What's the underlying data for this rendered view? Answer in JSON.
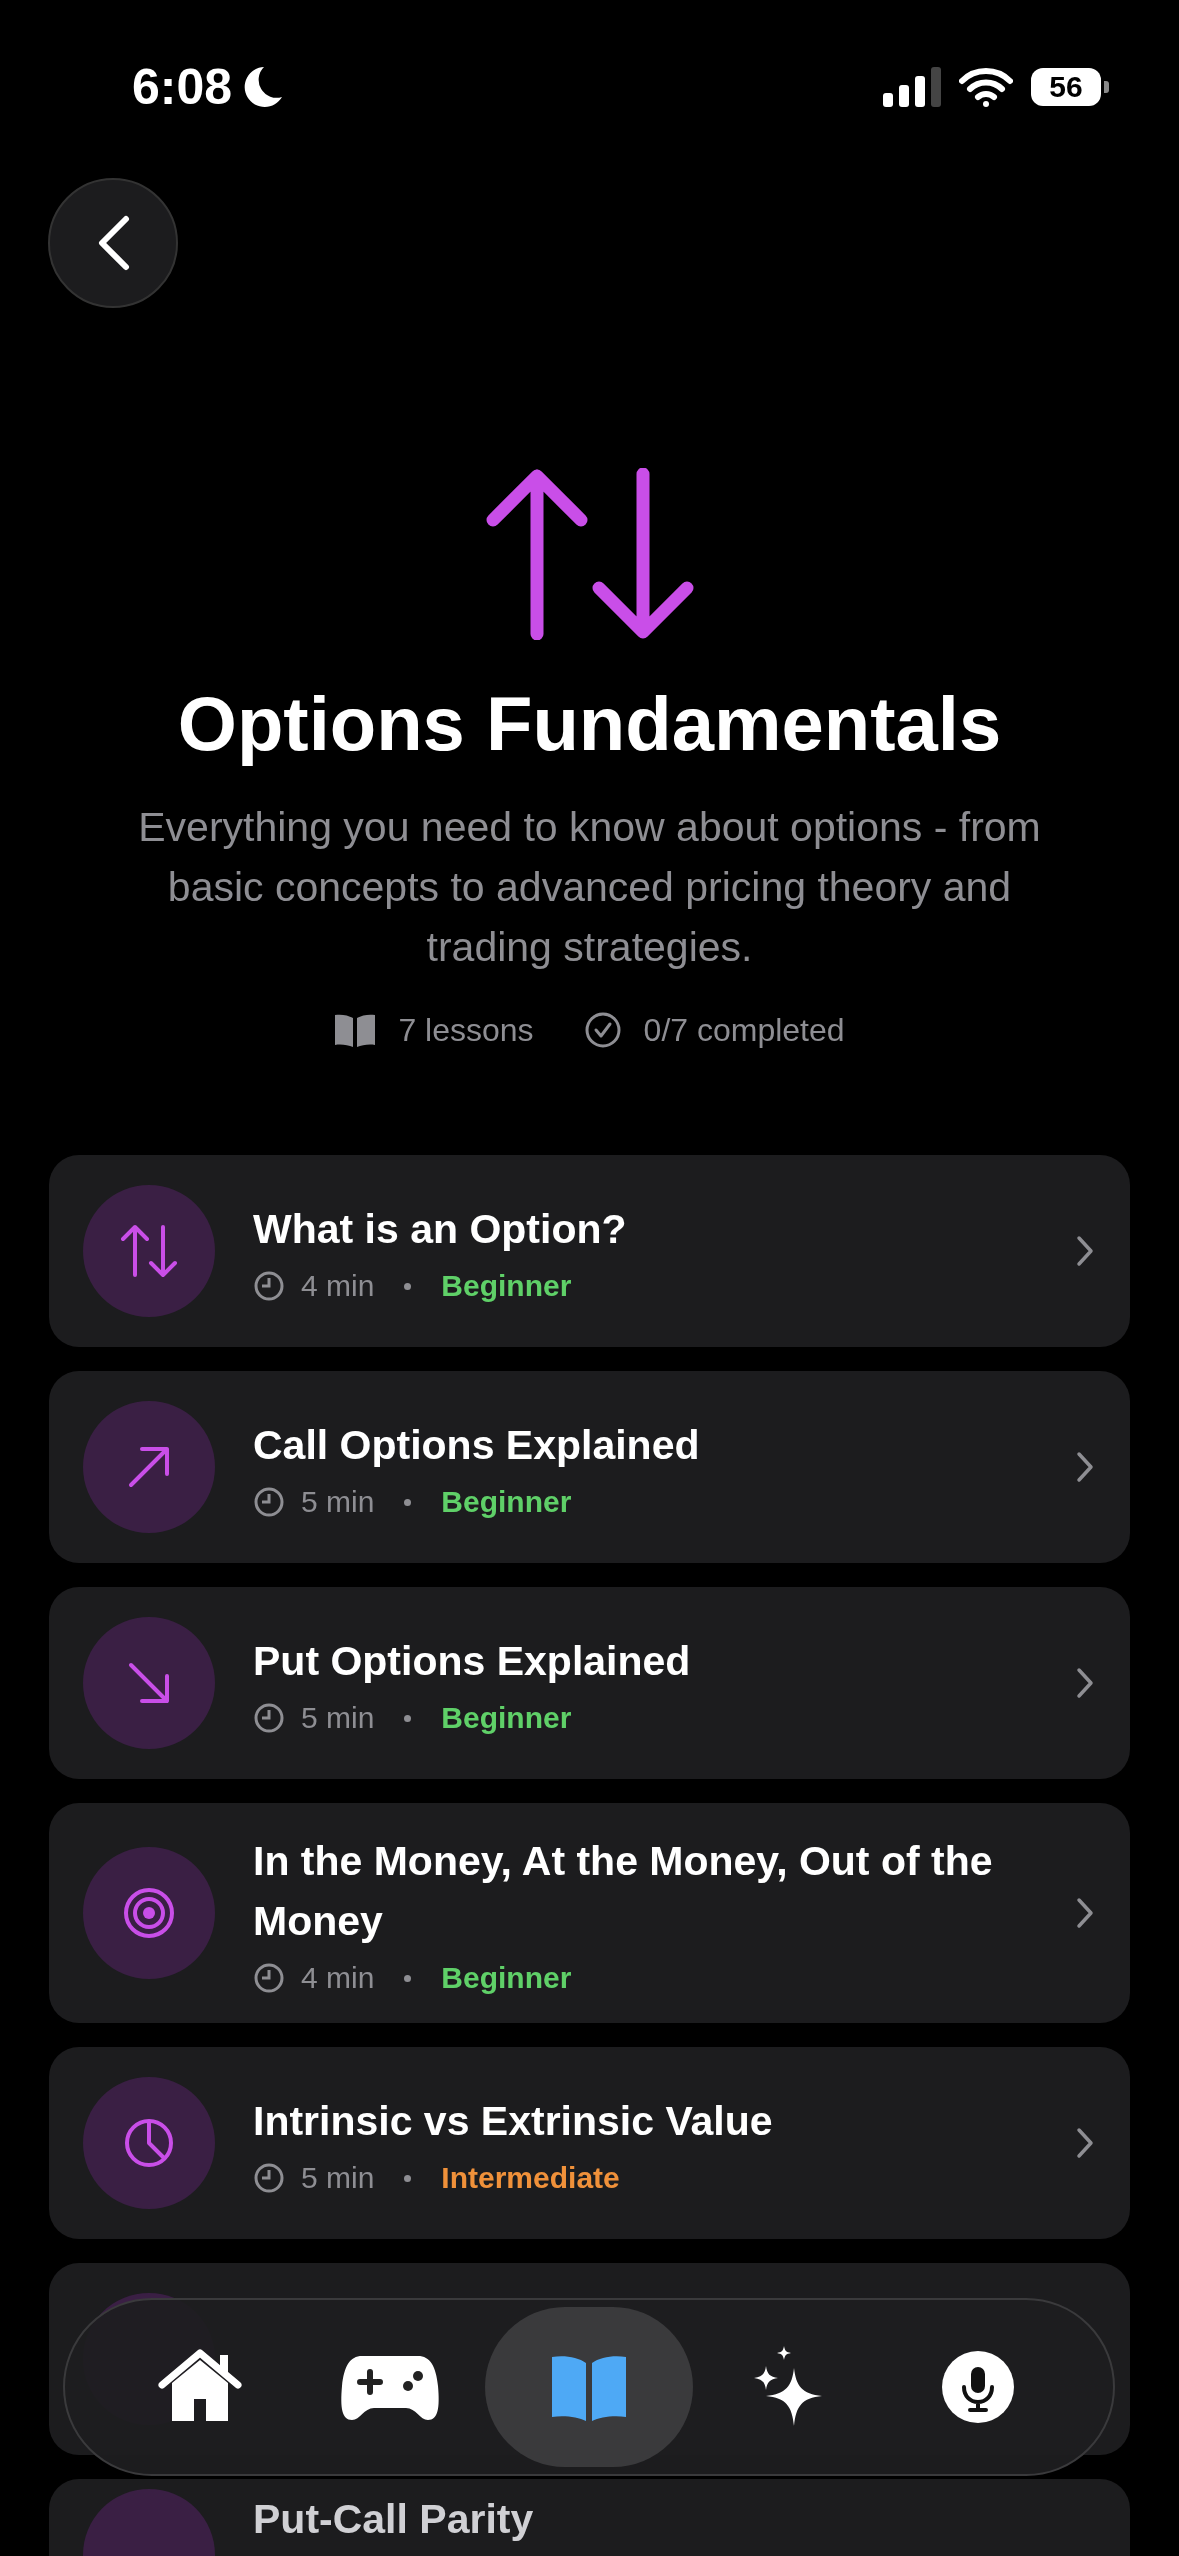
{
  "status_bar": {
    "time": "6:08",
    "battery": "56"
  },
  "course": {
    "title": "Options Fundamentals",
    "description": "Everything you need to know about options - from basic concepts to advanced pricing theory and trading strategies.",
    "lessons_count": "7 lessons",
    "completed": "0/7 completed"
  },
  "lessons": [
    {
      "kind": "arrows-up-down",
      "title": "What is an Option?",
      "duration": "4 min",
      "level": "Beginner",
      "color": "#5fd068"
    },
    {
      "kind": "arrow-up-right",
      "title": "Call Options Explained",
      "duration": "5 min",
      "level": "Beginner",
      "color": "#5fd068"
    },
    {
      "kind": "arrow-down-right",
      "title": "Put Options Explained",
      "duration": "5 min",
      "level": "Beginner",
      "color": "#5fd068"
    },
    {
      "kind": "target",
      "title": "In the Money, At the Money, Out of the Money",
      "duration": "4 min",
      "level": "Beginner",
      "color": "#5fd068"
    },
    {
      "kind": "pie",
      "title": "Intrinsic vs Extrinsic Value",
      "duration": "5 min",
      "level": "Intermediate",
      "color": "#f0913a"
    }
  ],
  "peek_lesson": {
    "title": "Put-Call Parity"
  },
  "tab_bar": [
    {
      "kind": "home",
      "selected": false
    },
    {
      "kind": "gamepad",
      "selected": false
    },
    {
      "kind": "book",
      "selected": true
    },
    {
      "kind": "sparkles",
      "selected": false
    },
    {
      "kind": "mic",
      "selected": false
    }
  ]
}
